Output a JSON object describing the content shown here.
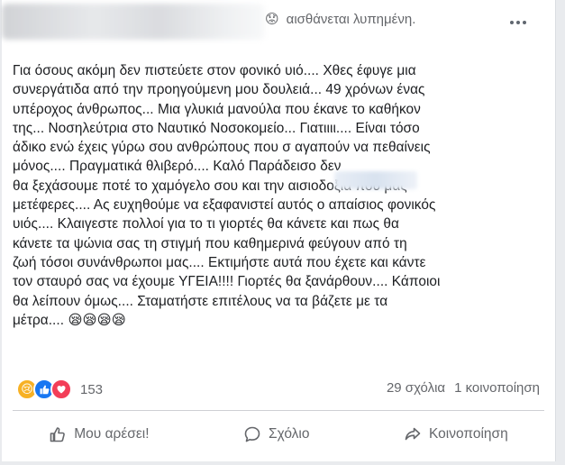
{
  "post": {
    "feeling_emoji": "😟",
    "feeling_text": "αισθάνεται λυπημένη.",
    "body": "Για όσους ακόμη δεν πιστεύετε στον φονικό υιό.... Χθες έφυγε μια\nσυνεργάτιδα από την προηγούμενη μου δουλειά... 49 χρόνων ένας\nυπέροχος άνθρωπος... Μια γλυκιά μανούλα που έκανε το καθήκον\nτης... Νοσηλεύτρια στο Ναυτικό Νοσοκομείο... Γιατιιιι.... Είναι τόσο\nάδικο ενώ έχεις γύρω σου ανθρώπους που σ αγαπούν  να πεθαίνεις\nμόνος.... Πραγματικά θλιβερό.... Καλό Παράδεισο                            δεν\nθα ξεχάσουμε ποτέ το χαμόγελο σου και την αισιοδοξία που μας\nμετέφερες.... Ας ευχηθούμε να εξαφανιστεί αυτός ο απαίσιος φονικός\nυιός.... Κλαιγεστε πολλοί για το τι γιορτές θα κάνετε και πως θα\nκάνετε τα ψώνια σας τη στιγμή που καθημερινά φεύγουν από τη\nζωή τόσοι συνάνθρωποι μας.... Εκτιμήστε αυτά που έχετε και κάντε\nτον σταυρό σας να έχουμε ΥΓΕΙΑ!!!! Γιορτές θα ξανάρθουν.... Κάποιοι\nθα λείπουν όμως.... Σταματήστε επιτέλους να τα βάζετε με τα\nμέτρα.... 😪😪😪😪"
  },
  "stats": {
    "reaction_icons": [
      "sad-react-icon",
      "like-react-icon",
      "love-react-icon"
    ],
    "reaction_count": "153",
    "comments": "29 σχόλια",
    "shares": "1 κοινοποίηση"
  },
  "actions": {
    "like": "Μου αρέσει!",
    "comment": "Σχόλιο",
    "share": "Κοινοποίηση"
  },
  "colors": {
    "text": "#1c1e21",
    "muted": "#65676b",
    "like_blue": "#1877f2",
    "love_red": "#f33e58",
    "sad_yellow": "#f7b125"
  }
}
